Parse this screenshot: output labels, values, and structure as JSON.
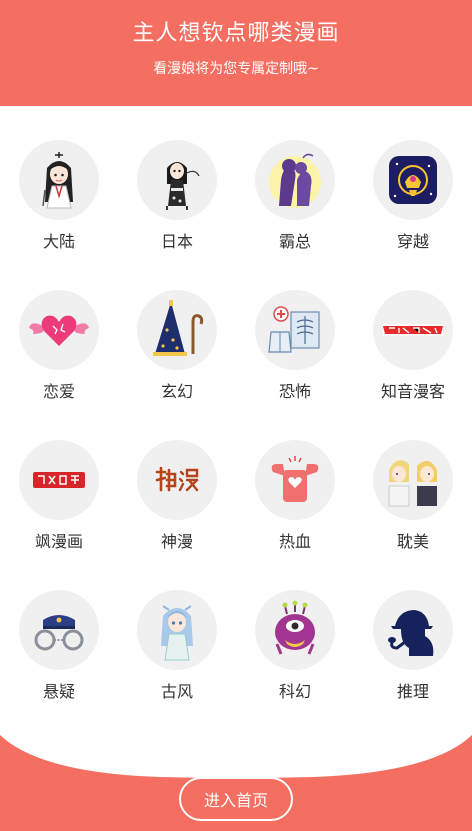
{
  "header": {
    "title": "主人想钦点哪类漫画",
    "subtitle": "看漫娘将为您专属定制哦~"
  },
  "categories": [
    {
      "label": "大陆",
      "icon": "chinese-girl-icon"
    },
    {
      "label": "日本",
      "icon": "kimono-girl-icon"
    },
    {
      "label": "霸总",
      "icon": "couple-kiss-icon"
    },
    {
      "label": "穿越",
      "icon": "portal-icon"
    },
    {
      "label": "恋爱",
      "icon": "winged-heart-icon"
    },
    {
      "label": "玄幻",
      "icon": "wizard-hat-icon"
    },
    {
      "label": "恐怖",
      "icon": "medical-xray-icon"
    },
    {
      "label": "知音漫客",
      "icon": "zhiyin-manke-logo-icon"
    },
    {
      "label": "飒漫画",
      "icon": "sa-manhua-logo-icon"
    },
    {
      "label": "神漫",
      "icon": "shenman-logo-icon"
    },
    {
      "label": "热血",
      "icon": "strong-heart-icon"
    },
    {
      "label": "耽美",
      "icon": "blonde-boys-icon"
    },
    {
      "label": "悬疑",
      "icon": "handcuffs-icon"
    },
    {
      "label": "古风",
      "icon": "ancient-girl-icon"
    },
    {
      "label": "科幻",
      "icon": "alien-icon"
    },
    {
      "label": "推理",
      "icon": "detective-icon"
    }
  ],
  "footer": {
    "enter_label": "进入首页"
  },
  "colors": {
    "accent": "#f46f61"
  }
}
